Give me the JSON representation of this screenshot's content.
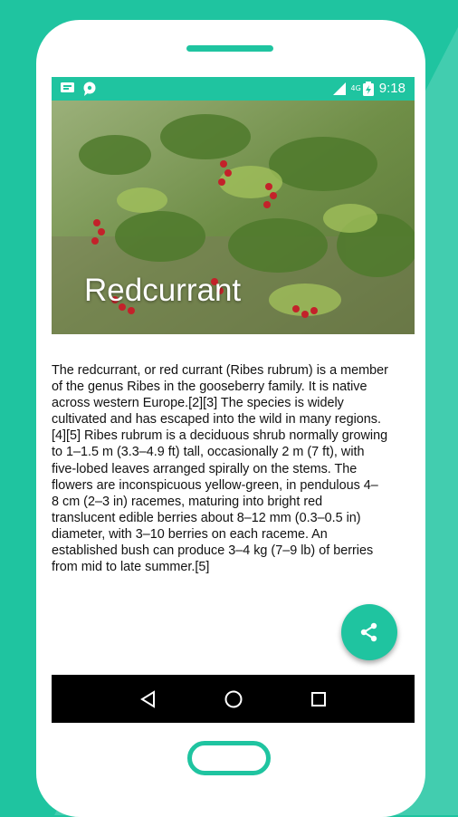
{
  "status_bar": {
    "time": "9:18",
    "network": "4G",
    "icons": [
      "message-icon",
      "chat-icon",
      "wifi-icon",
      "signal-icon",
      "battery-icon"
    ]
  },
  "hero": {
    "title": "Redcurrant"
  },
  "article": {
    "text": "The redcurrant, or red currant (Ribes rubrum) is a member\nof the genus Ribes in the gooseberry family. It is native\nacross western Europe.[2][3] The species is widely\ncultivated and has escaped into the wild in many regions.\n[4][5] Ribes rubrum is a deciduous shrub normally growing\nto 1–1.5 m (3.3–4.9 ft) tall, occasionally 2 m (7 ft), with\nfive-lobed leaves arranged spirally on the stems. The\nflowers are inconspicuous yellow-green, in pendulous 4–\n8 cm (2–3 in) racemes, maturing into bright red\ntranslucent edible berries about 8–12 mm (0.3–0.5 in)\ndiameter, with 3–10 berries on each raceme. An\nestablished bush can produce 3–4 kg (7–9 lb) of berries\nfrom mid to late summer.[5]"
  },
  "fab": {
    "icon": "share-icon"
  },
  "nav": {
    "icons": [
      "back-icon",
      "home-icon",
      "recents-icon"
    ]
  },
  "colors": {
    "accent": "#1fc4a0",
    "nav_bg": "#000000"
  }
}
